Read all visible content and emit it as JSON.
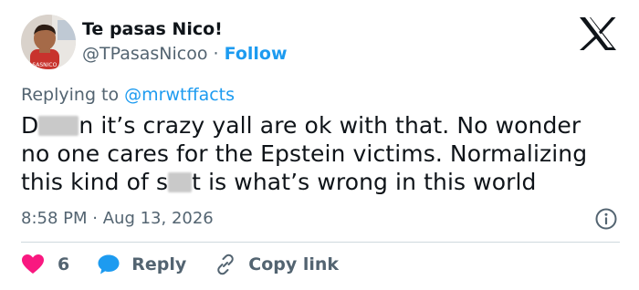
{
  "author": {
    "display_name": "Te pasas Nico!",
    "handle": "@TPasasNicoo",
    "separator": "·",
    "follow_label": "Follow",
    "avatar_watermark": "PASASNICO"
  },
  "reply_context": {
    "prefix": "Replying to",
    "mention": "@mrwtffacts"
  },
  "tweet": {
    "line1_start": "D",
    "line1_end": "n it’s crazy yall are ok with that. No wonder",
    "line2": "no one cares for the Epstein victims. Normalizing",
    "line3_start": "this kind of s",
    "line3_end": "t is what’s wrong in this world"
  },
  "timestamp": {
    "time": "8:58 PM",
    "separator": "·",
    "date": "Aug 13, 2026"
  },
  "actions": {
    "like_count": "6",
    "reply_label": "Reply",
    "copy_link_label": "Copy link"
  },
  "colors": {
    "accent": "#1d9bf0",
    "like": "#f91880",
    "text_secondary": "#536471"
  },
  "icons": [
    "x-logo-icon",
    "info-icon",
    "heart-icon",
    "reply-bubble-icon",
    "link-icon"
  ]
}
